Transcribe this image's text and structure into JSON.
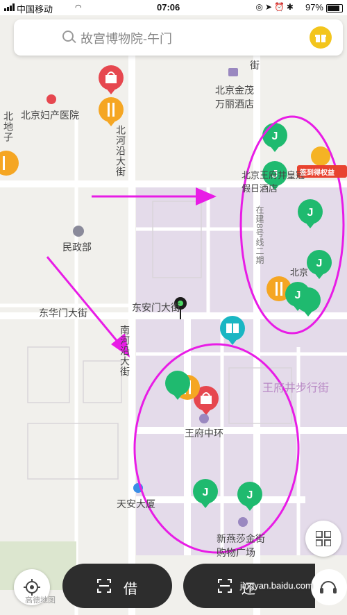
{
  "status_bar": {
    "carrier": "中国移动",
    "time": "07:06",
    "battery": "97%"
  },
  "search": {
    "text": "故宫博物院-午门"
  },
  "map_labels": {
    "hospital": "北京妇产医院",
    "hotel_jinmao": "北京金茂万丽酒店",
    "street_jie": "街",
    "beiheyan": "北河沿大街",
    "minzheng": "民政部",
    "donghuamen": "东华门大街",
    "donganmen": "东安门大街",
    "nanheyan": "南河沿大街",
    "wangfujing_walk": "王府井步行街",
    "wangfu_central": "王府中环",
    "tianan": "天安大厦",
    "xinyansha": "新燕莎金街购物广场",
    "left_edge": "北地子",
    "hotel_crowne": "北京王府井皇冠假日酒店",
    "metro8": "在建8号线二期",
    "beijing_right": "北京",
    "checkin_badge": "签到得权益"
  },
  "bottom": {
    "borrow": "借",
    "return": "还",
    "watermark": "jingyan.baidu.com",
    "map_logo": "高德地图"
  },
  "colors": {
    "accent_green": "#1fba6f",
    "bag_red": "#e6474f",
    "food_orange": "#f5a623",
    "book_teal": "#1ab6c3",
    "annotation": "#e81ce6",
    "district": "#e3d9e9"
  }
}
